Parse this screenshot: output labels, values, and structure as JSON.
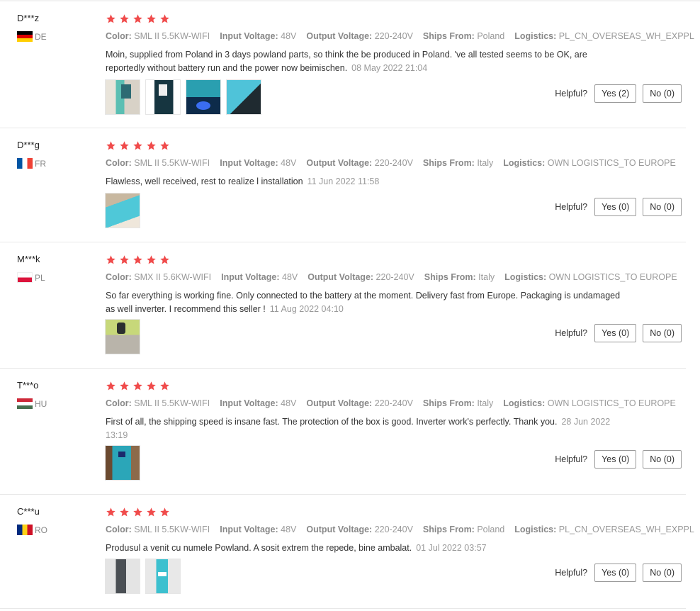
{
  "labels": {
    "color": "Color:",
    "input": "Input Voltage:",
    "output": "Output Voltage:",
    "ships": "Ships From:",
    "logistics": "Logistics:",
    "helpful": "Helpful?"
  },
  "reviews": [
    {
      "user": "D***z",
      "country": "DE",
      "rating": 5,
      "color": "SML II 5.5KW-WIFI",
      "input_voltage": "48V",
      "output_voltage": "220-240V",
      "ships_from": "Poland",
      "logistics": "PL_CN_OVERSEAS_WH_EXPPL",
      "text": "Moin, supplied from Poland in 3 days powland parts, so think the be produced in Poland. 've all tested seems to be OK, are reportedly without battery run and the power now beimischen.",
      "date": "08 May 2022 21:04",
      "yes": "Yes (2)",
      "no": "No (0)",
      "photo_count": 4
    },
    {
      "user": "D***g",
      "country": "FR",
      "rating": 5,
      "color": "SML II 5.5KW-WIFI",
      "input_voltage": "48V",
      "output_voltage": "220-240V",
      "ships_from": "Italy",
      "logistics": "OWN LOGISTICS_TO EUROPE",
      "text": "Flawless, well received, rest to realize l installation",
      "date": "11 Jun 2022 11:58",
      "yes": "Yes (0)",
      "no": "No (0)",
      "photo_count": 1
    },
    {
      "user": "M***k",
      "country": "PL",
      "rating": 5,
      "color": "SMX II 5.6KW-WIFI",
      "input_voltage": "48V",
      "output_voltage": "220-240V",
      "ships_from": "Italy",
      "logistics": "OWN LOGISTICS_TO EUROPE",
      "text": "So far everything is working fine. Only connected to the battery at the moment. Delivery fast from Europe. Packaging is undamaged as well inverter. I recommend this seller !",
      "date": "11 Aug 2022 04:10",
      "yes": "Yes (0)",
      "no": "No (0)",
      "photo_count": 1
    },
    {
      "user": "T***o",
      "country": "HU",
      "rating": 5,
      "color": "SML II 5.5KW-WIFI",
      "input_voltage": "48V",
      "output_voltage": "220-240V",
      "ships_from": "Italy",
      "logistics": "OWN LOGISTICS_TO EUROPE",
      "text": "First of all, the shipping speed is insane fast. The protection of the box is good. Inverter work's perfectly. Thank you.",
      "date": "28 Jun 2022 13:19",
      "yes": "Yes (0)",
      "no": "No (0)",
      "photo_count": 1
    },
    {
      "user": "C***u",
      "country": "RO",
      "rating": 5,
      "color": "SML II 5.5KW-WIFI",
      "input_voltage": "48V",
      "output_voltage": "220-240V",
      "ships_from": "Poland",
      "logistics": "PL_CN_OVERSEAS_WH_EXPPL",
      "text": "Produsul a venit cu numele Powland. A sosit extrem the repede, bine ambalat.",
      "date": "01 Jul 2022 03:57",
      "yes": "Yes (0)",
      "no": "No (0)",
      "photo_count": 2
    }
  ],
  "star_color": "#f04b4b"
}
